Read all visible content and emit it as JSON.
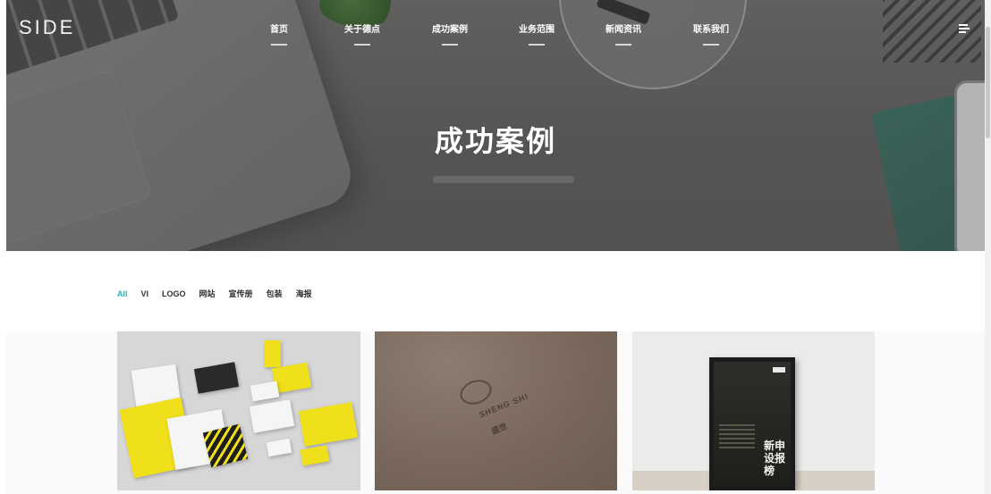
{
  "header": {
    "logo": "SIDE",
    "nav": [
      {
        "label": "首页"
      },
      {
        "label": "关于德点"
      },
      {
        "label": "成功案例"
      },
      {
        "label": "业务范围"
      },
      {
        "label": "新闻资讯"
      },
      {
        "label": "联系我们"
      }
    ],
    "menu_icon": "menu-icon"
  },
  "hero": {
    "title": "成功案例"
  },
  "filters": {
    "items": [
      "All",
      "VI",
      "LOGO",
      "网站",
      "宣传册",
      "包装",
      "海报"
    ],
    "active": "All",
    "active_color": "#2bb0b5"
  },
  "gallery": {
    "cards": [
      {
        "subject": "vi-stationery-mockup"
      },
      {
        "subject": "embossed-logo-mockup",
        "logo_text": "SHENG SHI",
        "logo_subtext": "盛世"
      },
      {
        "subject": "framed-poster-mockup",
        "poster_text_line1": "新申",
        "poster_text_line2": "设报",
        "poster_text_line3": "榜"
      }
    ]
  }
}
